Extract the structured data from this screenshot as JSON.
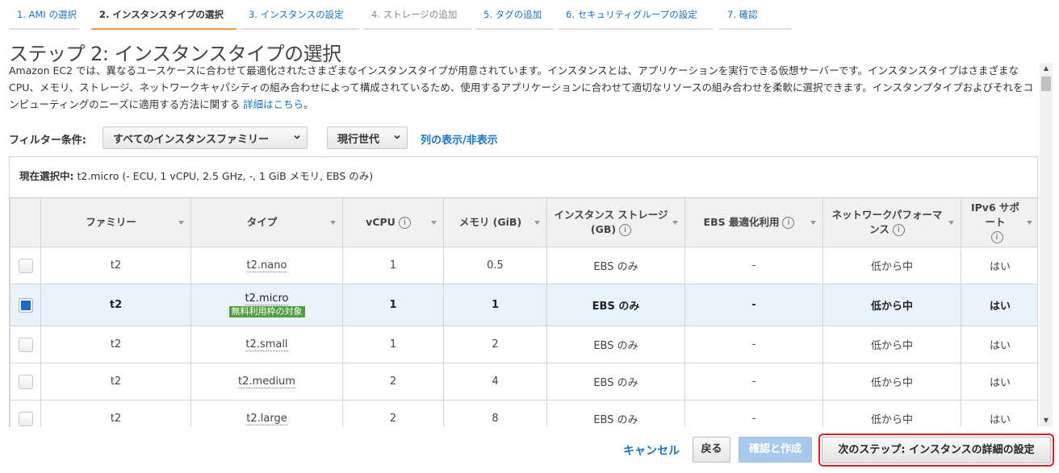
{
  "wizard": {
    "tabs": [
      {
        "label": "1. AMI の選択"
      },
      {
        "label": "2. インスタンスタイプの選択"
      },
      {
        "label": "3. インスタンスの設定"
      },
      {
        "label": "4. ストレージの追加"
      },
      {
        "label": "5. タグの追加"
      },
      {
        "label": "6. セキュリティグループの設定"
      },
      {
        "label": "7. 確認"
      }
    ]
  },
  "page": {
    "title": "ステップ 2: インスタンスタイプの選択",
    "description": "Amazon EC2 では、異なるユースケースに合わせて最適化されたさまざまなインスタンスタイプが用意されています。インスタンスとは、アプリケーションを実行できる仮想サーバーです。インスタンスタイプはさまざまな CPU、メモリ、ストレージ、ネットワークキャパシティの組み合わせによって構成されているため、使用するアプリケーションに合わせて適切なリソースの組み合わせを柔軟に選択できます。インスタンプタイプおよびそれをコンピューティングのニーズに適用する方法に関する",
    "details_link": "詳細はこちら",
    "description_end": "。"
  },
  "filters": {
    "label": "フィルター条件:",
    "family_value": "すべてのインスタンスファミリー",
    "generation_value": "現行世代",
    "columns_toggle": "列の表示/非表示"
  },
  "selection": {
    "label": "現在選択中:",
    "value": "t2.micro (- ECU, 1 vCPU, 2.5 GHz, -, 1 GiB メモリ, EBS のみ)"
  },
  "table": {
    "headers": {
      "family": "ファミリー",
      "type": "タイプ",
      "vcpu": "vCPU",
      "memory": "メモリ (GiB)",
      "storage": "インスタンス ストレージ (GB)",
      "ebs": "EBS 最適化利用",
      "network": "ネットワークパフォーマンス",
      "ipv6": "IPv6 サポート",
      "info": "i"
    },
    "free_tier_badge": "無料利用枠の対象",
    "rows": [
      {
        "family": "t2",
        "type": "t2.nano",
        "vcpu": "1",
        "memory": "0.5",
        "storage": "EBS のみ",
        "ebs": "-",
        "network": "低から中",
        "ipv6": "はい",
        "selected": false
      },
      {
        "family": "t2",
        "type": "t2.micro",
        "vcpu": "1",
        "memory": "1",
        "storage": "EBS のみ",
        "ebs": "-",
        "network": "低から中",
        "ipv6": "はい",
        "selected": true
      },
      {
        "family": "t2",
        "type": "t2.small",
        "vcpu": "1",
        "memory": "2",
        "storage": "EBS のみ",
        "ebs": "-",
        "network": "低から中",
        "ipv6": "はい",
        "selected": false
      },
      {
        "family": "t2",
        "type": "t2.medium",
        "vcpu": "2",
        "memory": "4",
        "storage": "EBS のみ",
        "ebs": "-",
        "network": "低から中",
        "ipv6": "はい",
        "selected": false
      },
      {
        "family": "t2",
        "type": "t2.large",
        "vcpu": "2",
        "memory": "8",
        "storage": "EBS のみ",
        "ebs": "-",
        "network": "低から中",
        "ipv6": "はい",
        "selected": false
      }
    ]
  },
  "footer": {
    "cancel": "キャンセル",
    "back": "戻る",
    "review_launch": "確認と作成",
    "next": "次のステップ: インスタンスの詳細の設定"
  },
  "colors": {
    "link": "#1a73c4",
    "active_tab_underline": "#e8a042",
    "selected_row": "#eaf3fb",
    "free_badge": "#4f9e3f",
    "highlight_ring": "#e02020"
  },
  "icons": {
    "dropdown": "chevron-down-icon",
    "sort": "sort-caret-icon",
    "info": "info-circle-icon",
    "scroll_up": "scroll-up-arrow-icon",
    "scroll_down": "scroll-down-arrow-icon"
  }
}
